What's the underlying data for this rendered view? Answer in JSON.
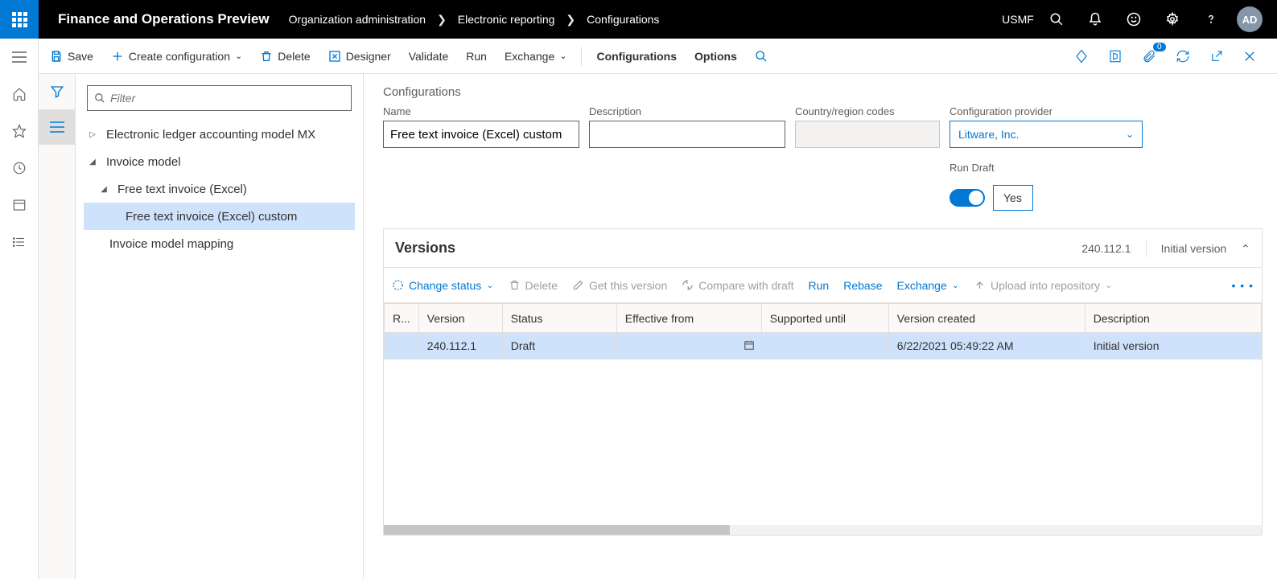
{
  "header": {
    "appTitle": "Finance and Operations Preview",
    "breadcrumb": [
      "Organization administration",
      "Electronic reporting",
      "Configurations"
    ],
    "company": "USMF",
    "avatar": "AD",
    "notifBadge": "0"
  },
  "actionbar": {
    "save": "Save",
    "createConfig": "Create configuration",
    "delete": "Delete",
    "designer": "Designer",
    "validate": "Validate",
    "run": "Run",
    "exchange": "Exchange",
    "configurations": "Configurations",
    "options": "Options"
  },
  "nav": {
    "filterPlaceholder": "Filter",
    "tree": {
      "n0": "Electronic ledger accounting model MX",
      "n1": "Invoice model",
      "n2": "Free text invoice (Excel)",
      "n3": "Free text invoice (Excel) custom",
      "n4": "Invoice model mapping"
    }
  },
  "form": {
    "sectionTitle": "Configurations",
    "nameLabel": "Name",
    "nameValue": "Free text invoice (Excel) custom",
    "descLabel": "Description",
    "descValue": "",
    "countryLabel": "Country/region codes",
    "countryValue": "",
    "providerLabel": "Configuration provider",
    "providerValue": "Litware, Inc.",
    "runDraftLabel": "Run Draft",
    "runDraftValue": "Yes"
  },
  "versions": {
    "title": "Versions",
    "headVersion": "240.112.1",
    "headDesc": "Initial version",
    "toolbar": {
      "changeStatus": "Change status",
      "delete": "Delete",
      "getVersion": "Get this version",
      "compare": "Compare with draft",
      "run": "Run",
      "rebase": "Rebase",
      "exchange": "Exchange",
      "upload": "Upload into repository"
    },
    "columns": {
      "r": "R...",
      "version": "Version",
      "status": "Status",
      "effective": "Effective from",
      "supported": "Supported until",
      "created": "Version created",
      "description": "Description"
    },
    "row": {
      "version": "240.112.1",
      "status": "Draft",
      "effective": "",
      "supported": "",
      "created": "6/22/2021 05:49:22 AM",
      "description": "Initial version"
    }
  }
}
